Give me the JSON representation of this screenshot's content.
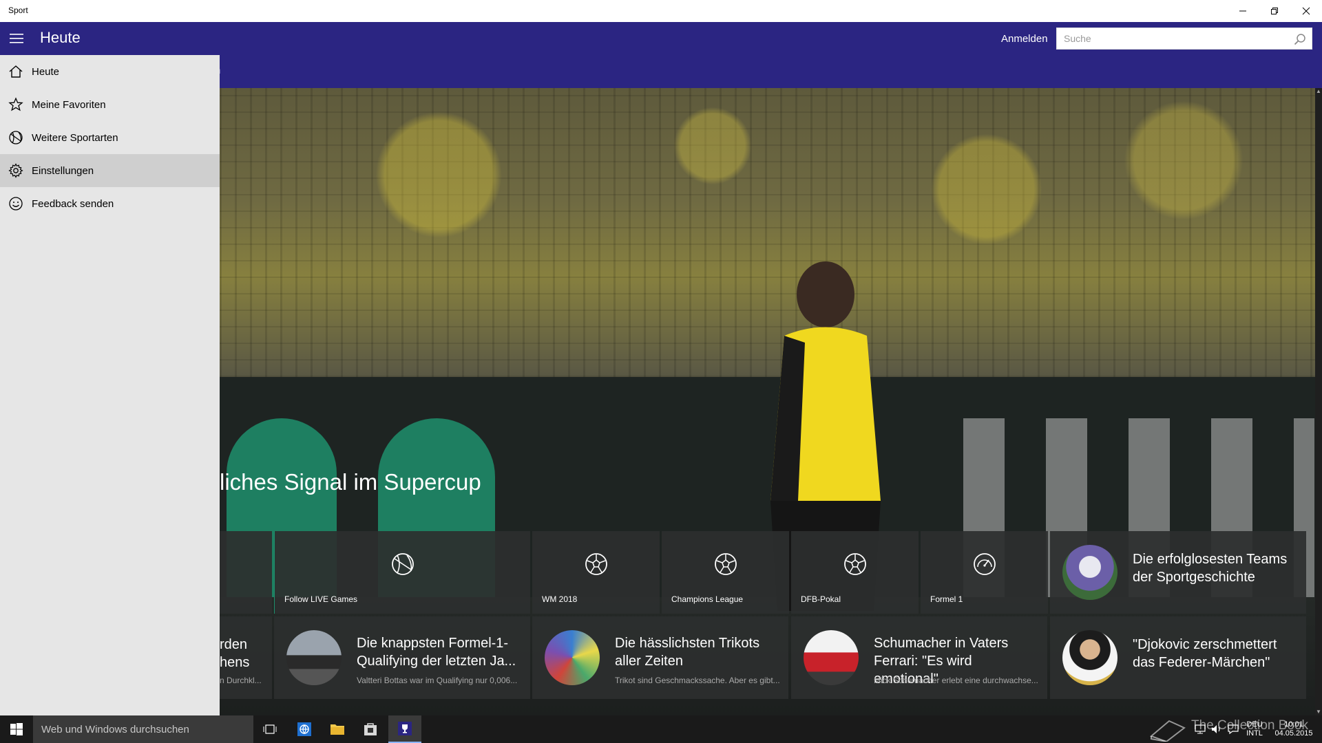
{
  "window": {
    "title": "Sport"
  },
  "header": {
    "page_title": "Heute",
    "login_label": "Anmelden",
    "search_placeholder": "Suche",
    "subnav_fragment": "n"
  },
  "nav": {
    "items": [
      {
        "label": "Heute",
        "icon": "home-icon"
      },
      {
        "label": "Meine Favoriten",
        "icon": "star-icon"
      },
      {
        "label": "Weitere Sportarten",
        "icon": "basketball-icon"
      },
      {
        "label": "Einstellungen",
        "icon": "gear-icon",
        "selected": true
      },
      {
        "label": "Feedback senden",
        "icon": "smiley-icon"
      }
    ]
  },
  "hero": {
    "headline": "liches Signal im Supercup"
  },
  "categories": [
    {
      "label": "Follow LIVE Games",
      "icon": "basketball-icon"
    },
    {
      "label": "WM 2018",
      "icon": "soccer-ball-icon"
    },
    {
      "label": "Champions League",
      "icon": "soccer-ball-icon"
    },
    {
      "label": "DFB-Pokal",
      "icon": "soccer-ball-icon"
    },
    {
      "label": "Formel 1",
      "icon": "speedometer-icon"
    }
  ],
  "news": {
    "top_right": {
      "title": "Die erfolglosesten Teams der Sportgeschichte"
    },
    "partial_left": {
      "line1": "rden",
      "line2": "hens",
      "sub": "n Durchkl..."
    },
    "row": [
      {
        "title": "Die knappsten Formel-1-Qualifying der letzten Ja...",
        "sub": "Valtteri Bottas war im Qualifying nur 0,006..."
      },
      {
        "title": "Die hässlichsten Trikots aller Zeiten",
        "sub": "Trikot sind Geschmackssache. Aber es gibt..."
      },
      {
        "title": "Schumacher in Vaters Ferrari: \"Es wird emotional\"",
        "sub": "Mick Schumacher erlebt eine durchwachse..."
      },
      {
        "title": "\"Djokovic zerschmettert das Federer-Märchen\""
      }
    ]
  },
  "taskbar": {
    "search_placeholder": "Web und Windows durchsuchen",
    "lang_top": "DEU",
    "lang_bottom": "INTL",
    "time": "10:01",
    "date": "04.05.2015",
    "watermark": "The Collection Book"
  },
  "colors": {
    "accent": "#2b2582",
    "nav_bg": "#e6e6e6",
    "nav_selected": "#cfcfcf",
    "tile_bg": "#2d2f2f",
    "taskbar": "#1a1a1a"
  }
}
